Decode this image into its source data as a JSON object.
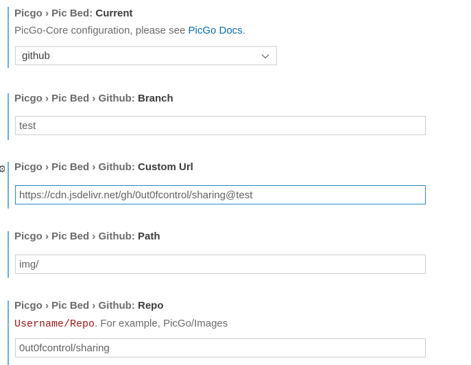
{
  "settings": {
    "current": {
      "prefix": "Picgo › Pic Bed: ",
      "key": "Current",
      "desc_before": "PicGo-Core configuration, please see ",
      "desc_link": "PicGo Docs",
      "desc_after": ".",
      "value": "github",
      "chevron_icon": "chevron-down-icon"
    },
    "branch": {
      "prefix": "Picgo › Pic Bed › Github: ",
      "key": "Branch",
      "value": "test"
    },
    "custom_url": {
      "gear_icon": "gear-icon",
      "prefix": "Picgo › Pic Bed › Github: ",
      "key": "Custom Url",
      "value": "https://cdn.jsdelivr.net/gh/0ut0fcontrol/sharing@test"
    },
    "path": {
      "prefix": "Picgo › Pic Bed › Github: ",
      "key": "Path",
      "value": "img/"
    },
    "repo": {
      "prefix": "Picgo › Pic Bed › Github: ",
      "key": "Repo",
      "desc_code": "Username/Repo",
      "desc_rest": ". For example, PicGo/Images",
      "value": "0ut0fcontrol/sharing"
    }
  },
  "colors": {
    "modified_indicator": "#66afe0",
    "link": "#006ab1",
    "code": "#a31515",
    "focus_border": "#2a84c4"
  }
}
